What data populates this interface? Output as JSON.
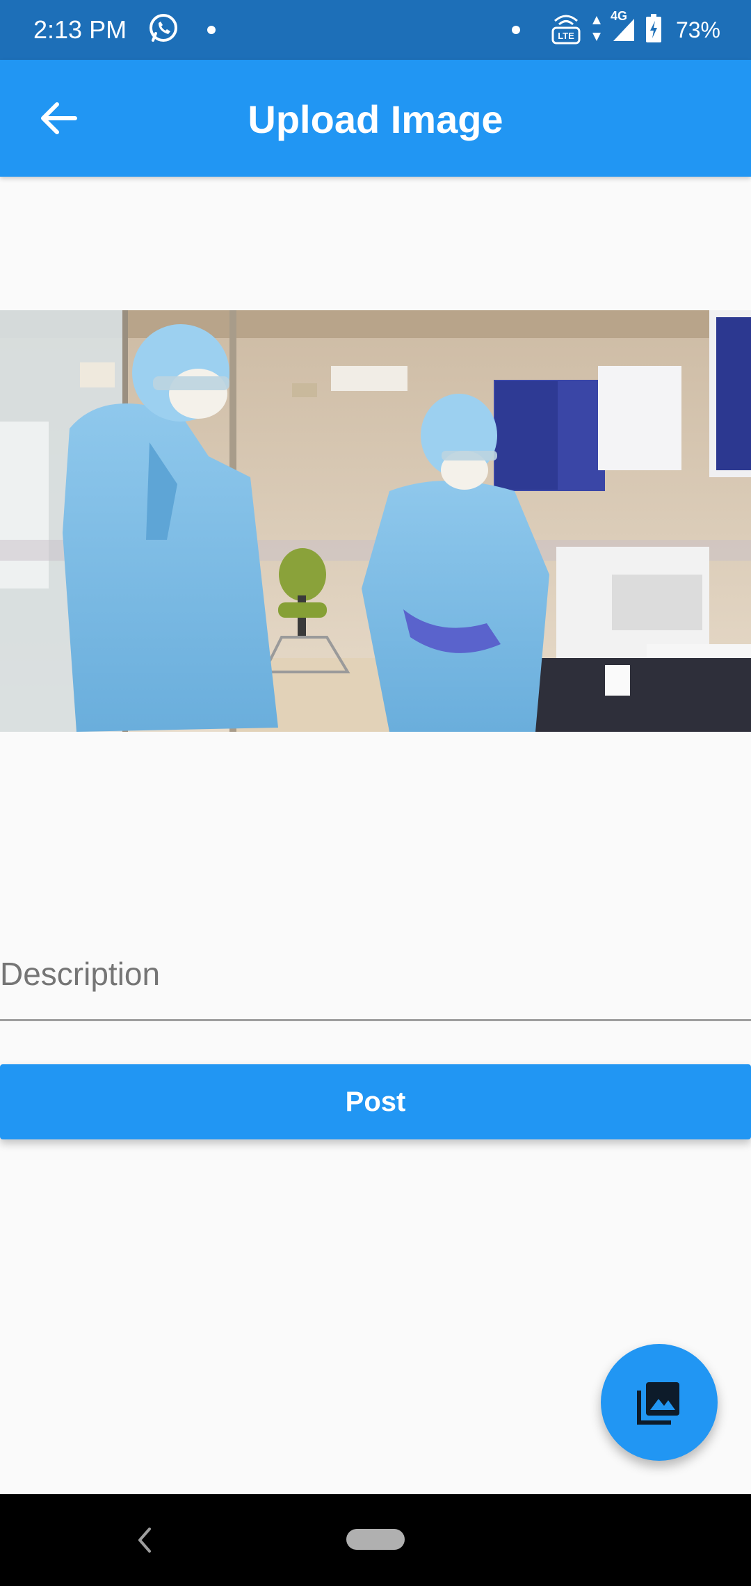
{
  "status_bar": {
    "time": "2:13 PM",
    "network": "4G",
    "volte": "VO LTE",
    "battery": "73%"
  },
  "app_bar": {
    "title": "Upload Image"
  },
  "image_preview": {
    "description": "Two people in blue protective suits, caps and masks standing in a laboratory"
  },
  "form": {
    "description_placeholder": "Description",
    "description_value": "",
    "post_label": "Post"
  },
  "colors": {
    "primary": "#2196f3",
    "status_bar": "#1d6fb8",
    "background": "#fafafa"
  },
  "icons": {
    "back": "arrow-left-icon",
    "fab": "photo-library-icon",
    "whatsapp": "whatsapp-icon"
  }
}
